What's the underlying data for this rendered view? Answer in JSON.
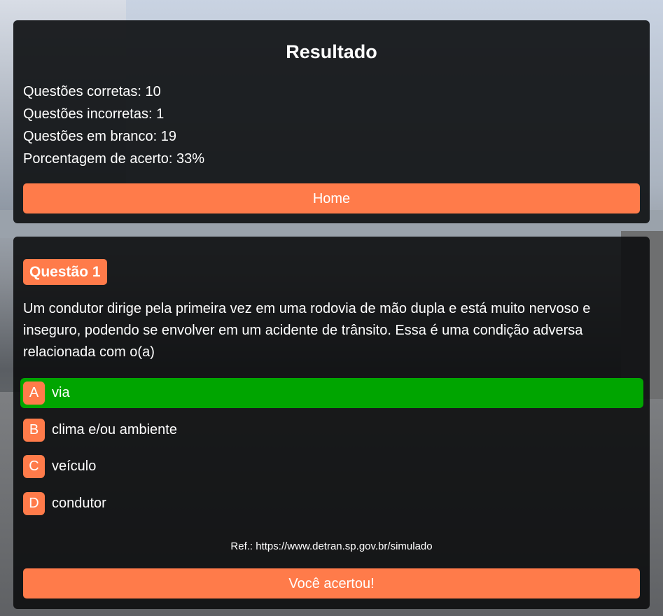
{
  "result": {
    "title": "Resultado",
    "stats": [
      "Questões corretas: 10",
      "Questões incorretas: 1",
      "Questões em branco: 19",
      "Porcentagem de acerto: 33%"
    ],
    "home_label": "Home"
  },
  "question": {
    "badge": "Questão 1",
    "text": "Um condutor dirige pela primeira vez em uma rodovia de mão dupla e está muito nervoso e inseguro, podendo se envolver em um acidente de trânsito. Essa é uma condição adversa relacionada com o(a)",
    "options": [
      {
        "letter": "A",
        "label": "via",
        "state": "correct"
      },
      {
        "letter": "B",
        "label": "clima e/ou ambiente",
        "state": "neutral"
      },
      {
        "letter": "C",
        "label": "veículo",
        "state": "neutral"
      },
      {
        "letter": "D",
        "label": "condutor",
        "state": "neutral"
      }
    ],
    "reference": "Ref.: https://www.detran.sp.gov.br/simulado",
    "feedback_label": "Você acertou!"
  },
  "colors": {
    "accent": "#ff7b4a",
    "correct": "#00a500",
    "card_bg": "#111315"
  }
}
